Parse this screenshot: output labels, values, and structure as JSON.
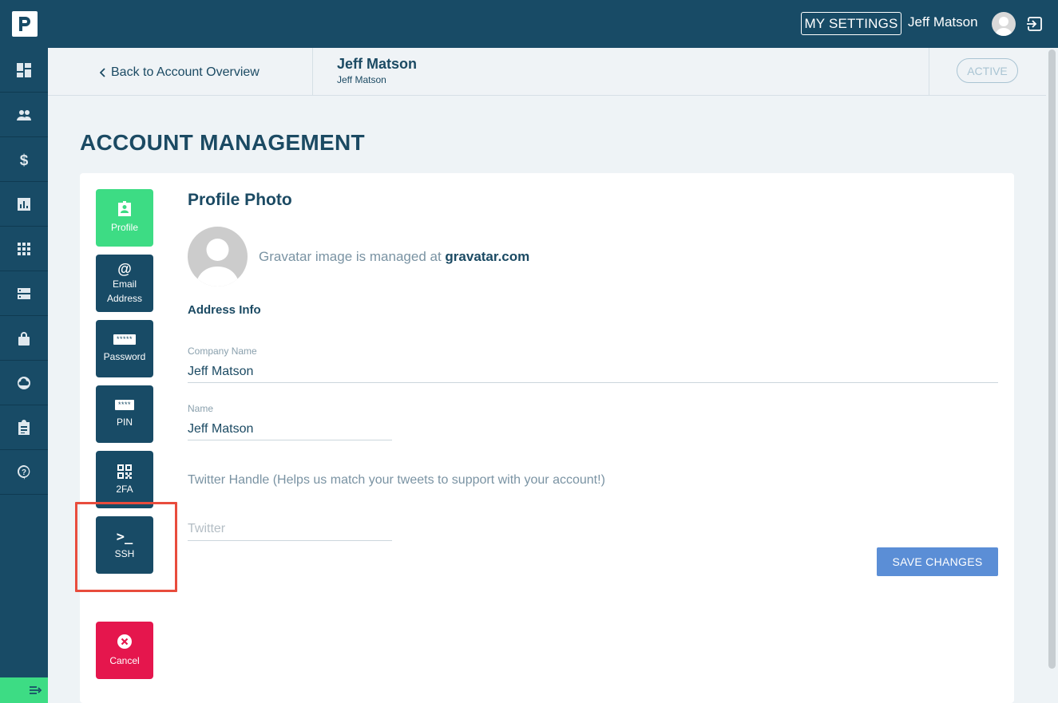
{
  "topbar": {
    "my_settings_label": "MY SETTINGS",
    "user_name": "Jeff Matson"
  },
  "header": {
    "back_label": "Back to Account Overview",
    "account_name": "Jeff Matson",
    "account_sub": "Jeff Matson",
    "status": "ACTIVE"
  },
  "page": {
    "title": "ACCOUNT MANAGEMENT"
  },
  "tabs": {
    "profile": "Profile",
    "email_line1": "Email",
    "email_line2": "Address",
    "password_stars": "*****",
    "password": "Password",
    "pin_stars": "****",
    "pin": "PIN",
    "twofa": "2FA",
    "ssh_glyph": ">_",
    "ssh": "SSH",
    "cancel": "Cancel"
  },
  "profile": {
    "section_title": "Profile Photo",
    "gravatar_text": "Gravatar image is managed at ",
    "gravatar_link": "gravatar.com",
    "address_heading": "Address Info",
    "company_label": "Company Name",
    "company_value": "Jeff Matson",
    "name_label": "Name",
    "name_value": "Jeff Matson",
    "twitter_help": "Twitter Handle (Helps us match your tweets to support with your account!)",
    "twitter_placeholder": "Twitter",
    "save_label": "SAVE CHANGES"
  },
  "colors": {
    "navy": "#184b66",
    "green": "#3ddc84",
    "red": "#e5164d",
    "save_blue": "#5b8ed6",
    "highlight": "#e84c3d"
  }
}
